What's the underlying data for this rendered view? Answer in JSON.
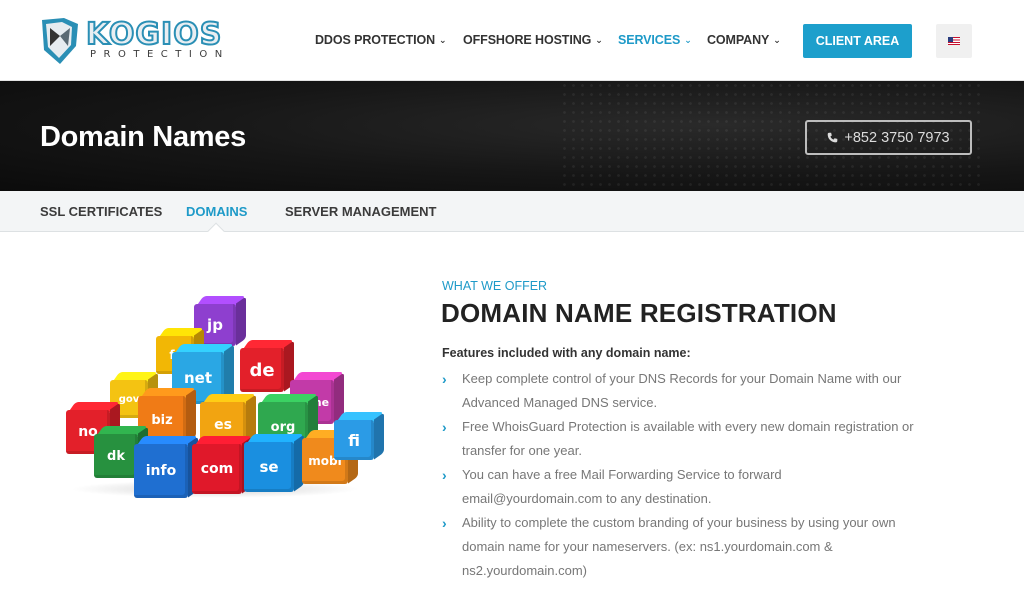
{
  "brand": {
    "name": "KOGIOS",
    "tagline": "PROTECTION"
  },
  "nav": {
    "items": [
      {
        "label": "DDOS PROTECTION",
        "has_dropdown": true,
        "active": false
      },
      {
        "label": "OFFSHORE HOSTING",
        "has_dropdown": true,
        "active": false
      },
      {
        "label": "SERVICES",
        "has_dropdown": true,
        "active": true
      },
      {
        "label": "COMPANY",
        "has_dropdown": true,
        "active": false
      }
    ],
    "client_area_label": "CLIENT AREA",
    "language_icon": "us-flag-icon"
  },
  "banner": {
    "title": "Domain Names",
    "phone": "+852 3750 7973",
    "phone_icon": "phone-icon"
  },
  "subnav": {
    "items": [
      {
        "label": "SSL CERTIFICATES",
        "active": false
      },
      {
        "label": "DOMAINS",
        "active": true
      },
      {
        "label": "SERVER MANAGEMENT",
        "active": false
      }
    ]
  },
  "content": {
    "eyebrow": "WHAT WE OFFER",
    "heading": "DOMAIN NAME REGISTRATION",
    "features_label": "Features included with any domain name:",
    "features": [
      "Keep complete control of your DNS Records for your Domain Name with our Advanced Managed DNS service.",
      "Free WhoisGuard Protection is available with every new domain registration or transfer for one year.",
      "You can have a free Mail Forwarding Service to forward email@yourdomain.com to any destination.",
      "Ability to complete the custom branding of your business by using your own domain name for your nameservers. (ex: ns1.yourdomain.com & ns2.yourdomain.com)"
    ]
  },
  "illustration": {
    "cubes": [
      {
        "label": "jp",
        "color": "#8e3fcf"
      },
      {
        "label": "fr",
        "color": "#f2b705"
      },
      {
        "label": "net",
        "color": "#2aa7e4"
      },
      {
        "label": "de",
        "color": "#e3202a"
      },
      {
        "label": "gov",
        "color": "#f4c312"
      },
      {
        "label": "name",
        "color": "#c23aa8"
      },
      {
        "label": "biz",
        "color": "#f07b16"
      },
      {
        "label": "es",
        "color": "#f2a411"
      },
      {
        "label": "org",
        "color": "#2fa84f"
      },
      {
        "label": "no",
        "color": "#e3202a"
      },
      {
        "label": "dk",
        "color": "#27913f"
      },
      {
        "label": "info",
        "color": "#1f6fd1"
      },
      {
        "label": "com",
        "color": "#e0182a"
      },
      {
        "label": "se",
        "color": "#1a8fe0"
      },
      {
        "label": "mobi",
        "color": "#f08a1c"
      },
      {
        "label": "fi",
        "color": "#2b9be6"
      }
    ]
  },
  "colors": {
    "accent": "#1e9ac8",
    "banner_bg": "#141414",
    "subnav_bg": "#f3f5f6"
  }
}
